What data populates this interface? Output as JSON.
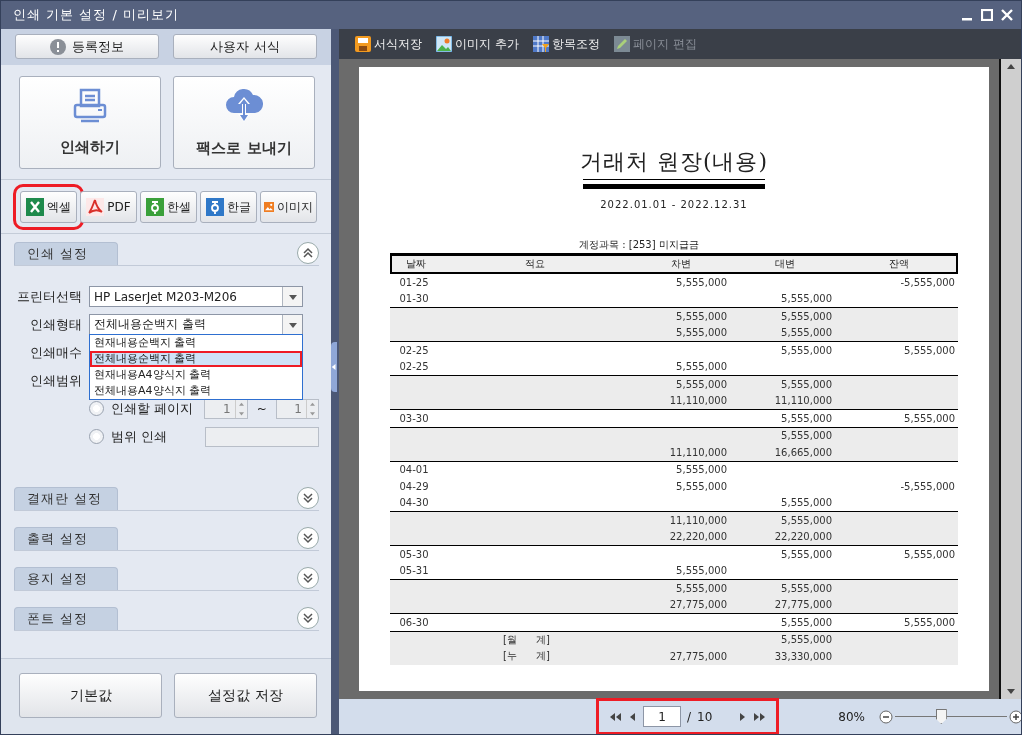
{
  "window": {
    "title": "인쇄 기본 설정 / 미리보기"
  },
  "top_buttons": [
    {
      "label": "등록정보",
      "kind": "info"
    },
    {
      "label": "사용자 서식",
      "kind": "plain"
    }
  ],
  "action_buttons": [
    {
      "label": "인쇄하기",
      "kind": "print"
    },
    {
      "label": "팩스로 보내기",
      "kind": "fax"
    }
  ],
  "export_buttons": [
    {
      "label": "엑셀",
      "kind": "excel",
      "highlighted": true
    },
    {
      "label": "PDF",
      "kind": "pdf",
      "highlighted": false
    },
    {
      "label": "한셀",
      "kind": "hancell",
      "highlighted": false
    },
    {
      "label": "한글",
      "kind": "hangul",
      "highlighted": false
    },
    {
      "label": "이미지",
      "kind": "image",
      "highlighted": false
    }
  ],
  "sections": [
    {
      "title": "인쇄 설정",
      "expanded": true,
      "settings": {
        "printer": {
          "label": "프린터선택",
          "value": "HP LaserJet M203-M206"
        },
        "mode": {
          "label": "인쇄형태",
          "value": "전체내용순백지 출력",
          "open": true,
          "options": [
            {
              "label": "현재내용순백지 출력",
              "selected": false,
              "highlighted": false
            },
            {
              "label": "전체내용순백지 출력",
              "selected": true,
              "highlighted": true
            },
            {
              "label": "현재내용A4양식지 출력",
              "selected": false,
              "highlighted": false
            },
            {
              "label": "전체내용A4양식지 출력",
              "selected": false,
              "highlighted": false
            }
          ]
        },
        "copies": {
          "label": "인쇄매수"
        },
        "range": {
          "label": "인쇄범위",
          "options": [
            {
              "kind": "pages",
              "label": "인쇄할 페이지",
              "selected": false,
              "from": "1",
              "separator": "~",
              "to": "1"
            },
            {
              "kind": "custom",
              "label": "범위 인쇄",
              "selected": false
            }
          ]
        }
      }
    },
    {
      "title": "결재란 설정",
      "expanded": false
    },
    {
      "title": "출력 설정",
      "expanded": false
    },
    {
      "title": "용지 설정",
      "expanded": false
    },
    {
      "title": "폰트 설정",
      "expanded": false
    }
  ],
  "footer_buttons": [
    "기본값",
    "설정값 저장"
  ],
  "toolbar": [
    {
      "label": "서식저장",
      "kind": "save",
      "disabled": false
    },
    {
      "label": "이미지 추가",
      "kind": "image",
      "disabled": false
    },
    {
      "label": "항목조정",
      "kind": "columns",
      "disabled": false
    },
    {
      "label": "페이지 편집",
      "kind": "edit",
      "disabled": true
    }
  ],
  "report": {
    "title": "거래처 원장(내용)",
    "period": "2022.01.01 - 2022.12.31",
    "account": "계정과목 : [253] 미지급금",
    "columns": [
      "날짜",
      "적요",
      "차변",
      "대변",
      "잔액"
    ],
    "rows": [
      {
        "kind": "entry",
        "date": "01-25",
        "debit": "5,555,000",
        "balance": "-5,555,000"
      },
      {
        "kind": "entry",
        "date": "01-30",
        "credit": "5,555,000"
      },
      {
        "kind": "subtotal",
        "debit": "5,555,000",
        "credit": "5,555,000"
      },
      {
        "kind": "subtotal",
        "debit": "5,555,000",
        "credit": "5,555,000"
      },
      {
        "kind": "entry",
        "date": "02-25",
        "credit": "5,555,000",
        "balance": "5,555,000"
      },
      {
        "kind": "entry",
        "date": "02-25",
        "debit": "5,555,000"
      },
      {
        "kind": "subtotal",
        "debit": "5,555,000",
        "credit": "5,555,000"
      },
      {
        "kind": "subtotal",
        "debit": "11,110,000",
        "credit": "11,110,000"
      },
      {
        "kind": "entry",
        "date": "03-30",
        "credit": "5,555,000",
        "balance": "5,555,000"
      },
      {
        "kind": "subtotal",
        "credit": "5,555,000"
      },
      {
        "kind": "subtotal",
        "debit": "11,110,000",
        "credit": "16,665,000"
      },
      {
        "kind": "entry",
        "date": "04-01",
        "debit": "5,555,000"
      },
      {
        "kind": "entry",
        "date": "04-29",
        "debit": "5,555,000",
        "balance": "-5,555,000"
      },
      {
        "kind": "entry",
        "date": "04-30",
        "credit": "5,555,000"
      },
      {
        "kind": "subtotal",
        "debit": "11,110,000",
        "credit": "5,555,000"
      },
      {
        "kind": "subtotal",
        "debit": "22,220,000",
        "credit": "22,220,000"
      },
      {
        "kind": "entry",
        "date": "05-30",
        "credit": "5,555,000",
        "balance": "5,555,000"
      },
      {
        "kind": "entry",
        "date": "05-31",
        "debit": "5,555,000"
      },
      {
        "kind": "subtotal",
        "debit": "5,555,000",
        "credit": "5,555,000"
      },
      {
        "kind": "subtotal",
        "debit": "27,775,000",
        "credit": "27,775,000"
      },
      {
        "kind": "entry",
        "date": "06-30",
        "credit": "5,555,000",
        "balance": "5,555,000"
      },
      {
        "kind": "subtotal",
        "memo": "[월      계]",
        "credit": "5,555,000"
      },
      {
        "kind": "subtotal",
        "memo": "[누      계]",
        "debit": "27,775,000",
        "credit": "33,330,000"
      }
    ]
  },
  "pager": {
    "page": "1",
    "separator": "/",
    "total": "10",
    "highlighted": true
  },
  "zoom": {
    "reading": "80%",
    "level": 0.4
  }
}
